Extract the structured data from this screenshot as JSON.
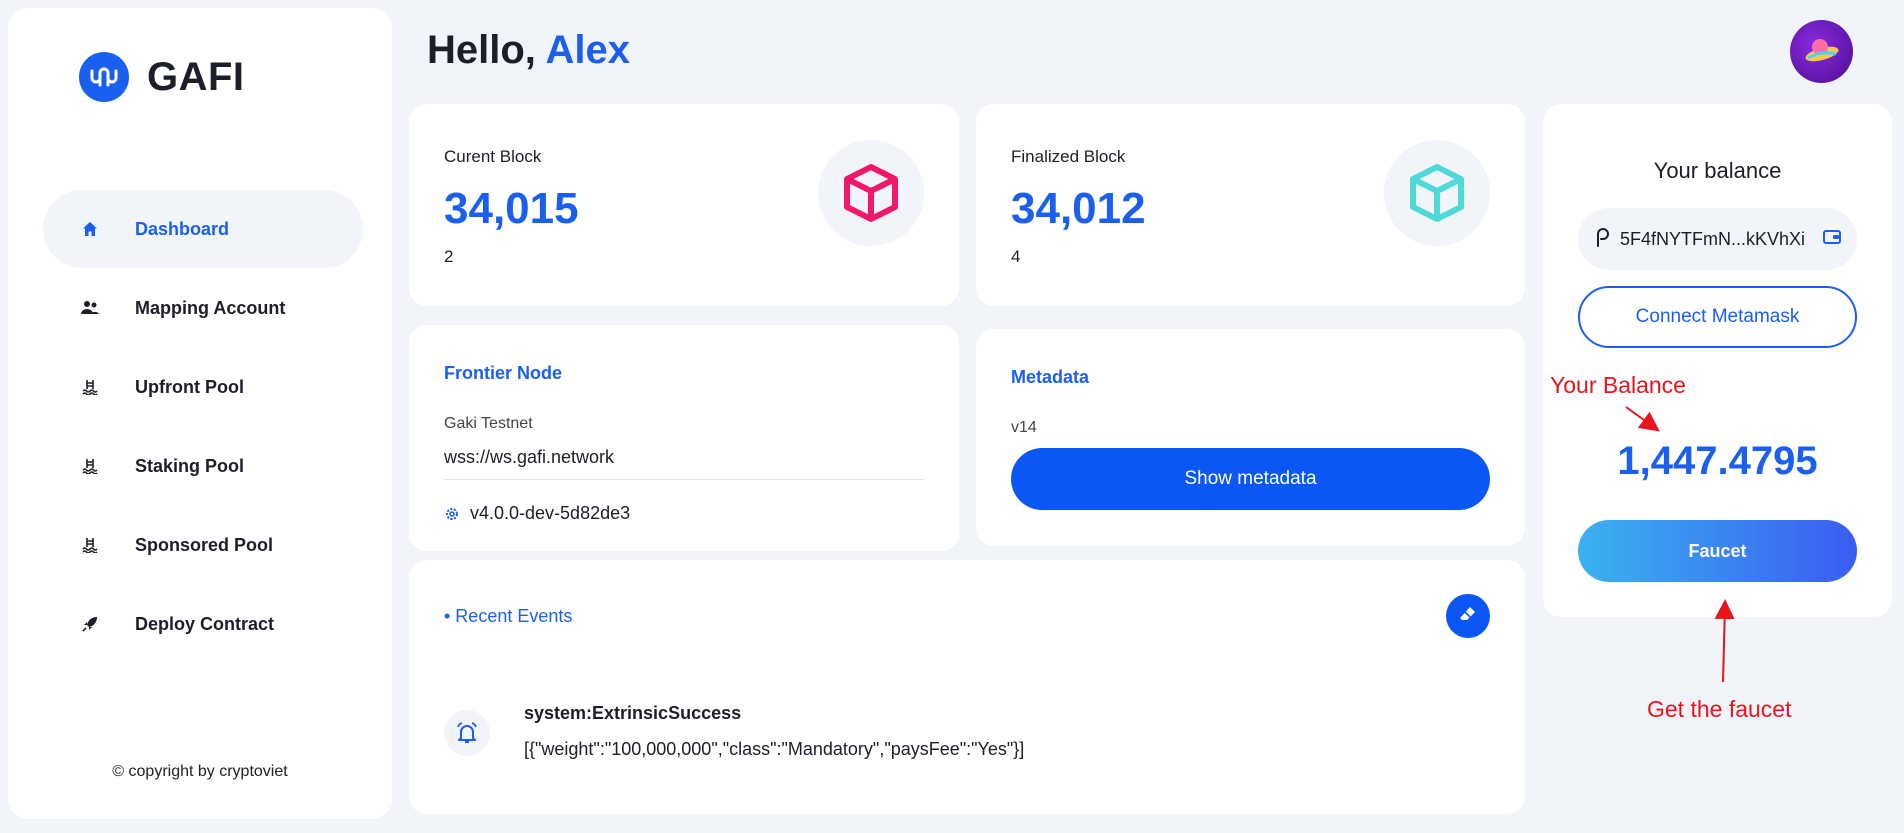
{
  "brand": {
    "name": "GAFI",
    "color": "#1a5ff0"
  },
  "sidebar": {
    "items": [
      {
        "label": "Dashboard",
        "icon": "home-icon",
        "active": true
      },
      {
        "label": "Mapping Account",
        "icon": "users-icon",
        "active": false
      },
      {
        "label": "Upfront Pool",
        "icon": "pool-icon",
        "active": false
      },
      {
        "label": "Staking Pool",
        "icon": "pool-icon",
        "active": false
      },
      {
        "label": "Sponsored Pool",
        "icon": "pool-icon",
        "active": false
      },
      {
        "label": "Deploy Contract",
        "icon": "rocket-icon",
        "active": false
      }
    ],
    "copyright": "© copyright by cryptoviet"
  },
  "header": {
    "greeting": "Hello,",
    "user_name": "Alex"
  },
  "current_block": {
    "label": "Curent Block",
    "value": "34,015",
    "sub": "2",
    "icon_color": "#f0176d"
  },
  "finalized_block": {
    "label": "Finalized Block",
    "value": "34,012",
    "sub": "4",
    "icon_color": "#4ed8d8"
  },
  "frontier": {
    "title": "Frontier Node",
    "network_label": "Gaki Testnet",
    "url": "wss://ws.gafi.network",
    "version": "v4.0.0-dev-5d82de3"
  },
  "metadata": {
    "title": "Metadata",
    "version": "v14",
    "button_label": "Show metadata"
  },
  "events": {
    "title": "• Recent Events",
    "items": [
      {
        "name": "system:ExtrinsicSuccess",
        "data": "[{\"weight\":\"100,000,000\",\"class\":\"Mandatory\",\"paysFee\":\"Yes\"}]"
      }
    ]
  },
  "balance": {
    "title": "Your balance",
    "address": "5F4fNYTFmN...kKVhXi",
    "connect_label": "Connect Metamask",
    "value": "1,447.4795",
    "faucet_label": "Faucet"
  },
  "annotations": {
    "balance_note": "Your Balance",
    "faucet_note": "Get the faucet",
    "color": "#e8141b"
  }
}
